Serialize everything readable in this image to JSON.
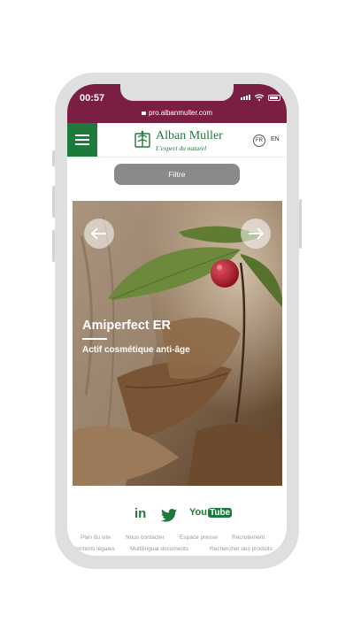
{
  "status_bar": {
    "time": "00:57",
    "url": "pro.albanmuller.com"
  },
  "header": {
    "brand_name": "Alban Muller",
    "brand_tagline": "L'expert du naturel",
    "lang_fr": "FR",
    "lang_en": "EN"
  },
  "filter": {
    "label": "Filtre"
  },
  "hero": {
    "title": "Amiperfect ER",
    "subtitle": "Actif cosmétique anti-âge"
  },
  "social": {
    "linkedin": "in",
    "youtube_you": "You",
    "youtube_tube": "Tube"
  },
  "footer": {
    "links_row1": [
      "Plan du site",
      "Nous contacter",
      "Espace presse",
      "Recrutement"
    ],
    "links_row2": [
      "Mentions légales",
      "Multilingual documents",
      "Rechercher des produits"
    ]
  },
  "colors": {
    "brand_green": "#1e7a3c",
    "status_bar": "#7a1f43",
    "filter_button": "#8a8a8a"
  }
}
